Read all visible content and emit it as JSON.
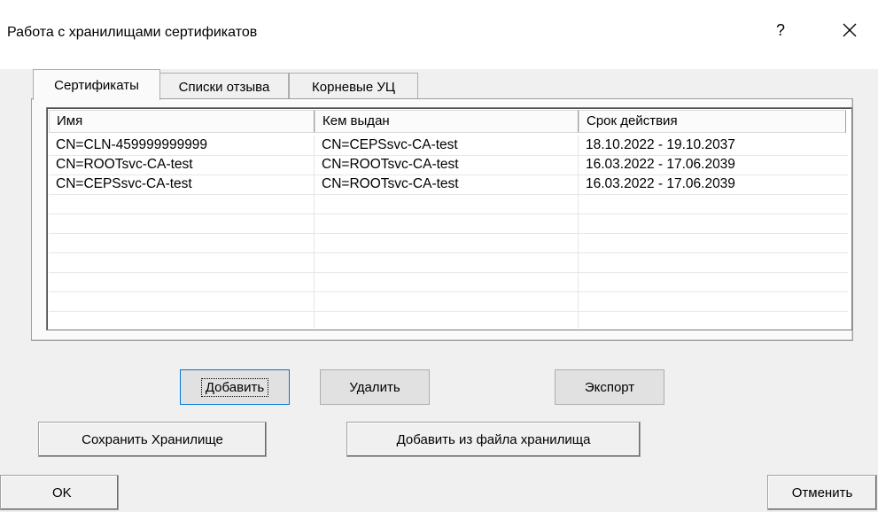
{
  "window": {
    "title": "Работа с хранилищами сертификатов",
    "help_glyph": "?",
    "close_icon": "close-icon"
  },
  "tabs": [
    {
      "label": "Сертификаты",
      "active": true
    },
    {
      "label": "Списки отзыва",
      "active": false
    },
    {
      "label": "Корневые УЦ",
      "active": false
    }
  ],
  "table": {
    "columns": [
      "Имя",
      "Кем выдан",
      "Срок действия"
    ],
    "rows": [
      [
        "CN=CLN-459999999999",
        "CN=CEPSsvc-CA-test",
        "18.10.2022 - 19.10.2037"
      ],
      [
        "CN=ROOTsvc-CA-test",
        "CN=ROOTsvc-CA-test",
        "16.03.2022 - 17.06.2039"
      ],
      [
        "CN=CEPSsvc-CA-test",
        "CN=ROOTsvc-CA-test",
        "16.03.2022 - 17.06.2039"
      ]
    ]
  },
  "buttons": {
    "add": "Добавить",
    "delete": "Удалить",
    "export": "Экспорт",
    "save_store": "Сохранить Хранилище",
    "add_from_file": "Добавить из файла хранилища",
    "ok": "OK",
    "cancel": "Отменить"
  }
}
